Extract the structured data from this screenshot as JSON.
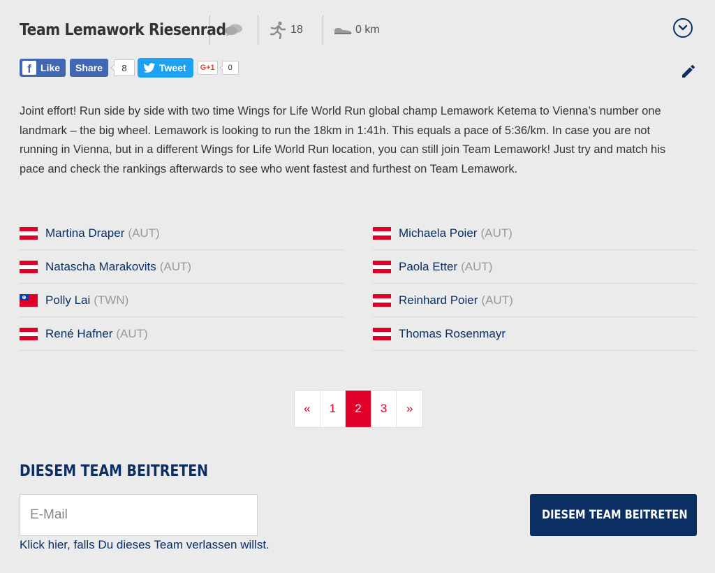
{
  "header": {
    "title": "Team Lemawork Riesenrad",
    "members_count": "18",
    "distance": "0 km"
  },
  "social": {
    "like_label": "Like",
    "share_label": "Share",
    "share_count": "8",
    "tweet_label": "Tweet",
    "gplus_label": "G+1",
    "gplus_count": "0"
  },
  "description": "Joint effort! Run side by side with two time Wings for Life World Run global champ Lemawork Ketema to Vienna’s number one landmark – the big wheel. Lemawork is looking to run the 18km in 1:41h. This equals a pace of 5:36/km. In case you are not running in Vienna, but in a different Wings for Life World Run location, you can still join Team Lemawork! Just try and match his pace and check the rankings afterwards to see who went fastest and furthest on Team Lemawork.",
  "members": [
    {
      "name": "Martina Draper",
      "country": "(AUT)",
      "flag": "austria"
    },
    {
      "name": "Michaela Poier",
      "country": "(AUT)",
      "flag": "austria"
    },
    {
      "name": "Natascha Marakovits",
      "country": "(AUT)",
      "flag": "austria"
    },
    {
      "name": "Paola Etter",
      "country": "(AUT)",
      "flag": "austria"
    },
    {
      "name": "Polly Lai",
      "country": "(TWN)",
      "flag": "taiwan"
    },
    {
      "name": "Reinhard Poier",
      "country": "(AUT)",
      "flag": "austria"
    },
    {
      "name": "René Hafner",
      "country": "(AUT)",
      "flag": "austria"
    },
    {
      "name": "Thomas Rosenmayr",
      "country": "",
      "flag": "austria"
    }
  ],
  "pagination": {
    "prev": "«",
    "pages": [
      "1",
      "2",
      "3"
    ],
    "current": "2",
    "next": "»"
  },
  "join": {
    "heading": "DIESEM TEAM BEITRETEN",
    "email_placeholder": "E-Mail",
    "button_label": "DIESEM TEAM BEITRETEN",
    "leave_link": "Klick hier, falls Du dieses Team verlassen willst."
  },
  "colors": {
    "navy": "#0b2f63",
    "accent_red": "#e2002a",
    "background": "#ebebeb",
    "facebook": "#4267b2",
    "twitter": "#1da1f2"
  },
  "icons": {
    "chat": "chat-bubbles-icon",
    "runner": "runner-icon",
    "shoe": "running-shoe-icon",
    "expand": "chevron-down-circle-icon",
    "edit": "pencil-icon"
  }
}
